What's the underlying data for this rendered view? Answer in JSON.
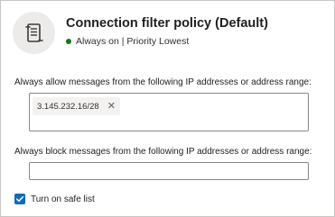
{
  "header": {
    "icon": "policy-document-icon",
    "title": "Connection filter policy (Default)",
    "status": "Always on | Priority Lowest",
    "status_color": "#107c10"
  },
  "allow_section": {
    "label": "Always allow messages from the following IP addresses or address range:",
    "tags": [
      {
        "value": "3.145.232.16/28",
        "remove_icon": "close-icon"
      }
    ]
  },
  "block_section": {
    "label": "Always block messages from the following IP addresses or address range:",
    "value": ""
  },
  "safe_list": {
    "label": "Turn on safe list",
    "checked": true,
    "accent_color": "#0f6cbd"
  }
}
